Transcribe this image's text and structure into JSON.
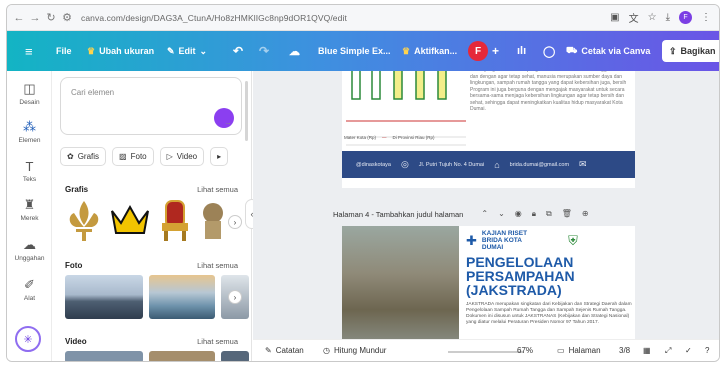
{
  "browser": {
    "url": "canva.com/design/DAG3A_CtunA/Ho8zHMKlIGc8np9dOR1QVQ/edit",
    "back_icon": "arrow-left-icon",
    "forward_icon": "arrow-right-icon",
    "reload_icon": "reload-icon",
    "profile_initial": "F"
  },
  "toolbar": {
    "menu_icon": "hamburger-icon",
    "file_label": "File",
    "resize_label": "Ubah ukuran",
    "edit_label": "Edit",
    "title_label": "Blue Simple Ex...",
    "activate_label": "Aktifkan...",
    "user_initial": "F",
    "print_label": "Cetak via Canva",
    "share_label": "Bagikan"
  },
  "rail": {
    "items": [
      {
        "label": "Desain",
        "icon": "layout-icon"
      },
      {
        "label": "Elemen",
        "icon": "shapes-icon"
      },
      {
        "label": "Teks",
        "icon": "text-icon"
      },
      {
        "label": "Merek",
        "icon": "brand-icon"
      },
      {
        "label": "Unggahan",
        "icon": "cloud-upload-icon"
      },
      {
        "label": "Alat",
        "icon": "pen-tool-icon"
      }
    ]
  },
  "panel": {
    "search_placeholder": "Cari elemen",
    "chips": [
      "Grafis",
      "Foto",
      "Video"
    ],
    "sections": [
      {
        "title": "Grafis",
        "see_all": "Lihat semua"
      },
      {
        "title": "Foto",
        "see_all": "Lihat semua"
      },
      {
        "title": "Video",
        "see_all": "Lihat semua"
      }
    ]
  },
  "page3": {
    "body_text": "Dinas yang memiliki mempengaruhi faktor-faktor rumah tangga mereka dan dengan agar tetap sehat, manusia merupakan sumber daya dan lingkungan, sampah rumah tangga yang dapat kebersihan juga, bersih Program ini juga berguna dengan mengajak masyarakat untuk secara bersama-sama menjaga kebersihan lingkungan agar tetap bersih dan sehat, sehingga dapat meningkatkan kualitas hidup masyarakat Kota Dumai.",
    "legend_a": "Mater Kota (Rp)",
    "legend_b": "Di Provinsi Riau (Rp)",
    "footer_social": "@dinaskotaya",
    "footer_address": "Jl. Putri Tujuh No. 4 Dumai",
    "footer_email": "brida.dumai@gmail.com"
  },
  "page4": {
    "header": "Halaman 4 - Tambahkan judul halaman",
    "org_line1": "KAJIAN RISET",
    "org_line2": "BRIDA KOTA",
    "org_line3": "DUMAI",
    "title": "PENGELOLAAN PERSAMPAHAN (JAKSTRADA)",
    "body_text": "JAKSTRADA merupakan singkatan dari Kebijakan dan Strategi Daerah dalam Pengelolaan Sampah Rumah Tangga dan Sampah Sejenis Rumah Tangga. Dokumen ini disusun untuk JAKSTRANAS (Kebijakan dan Strategi Nasional) yang diatur melalui Peraturan Presiden Nomor 97 Tahun 2017."
  },
  "bottom": {
    "notes_label": "Catatan",
    "timer_label": "Hitung Mundur",
    "zoom": "67%",
    "pages_label": "Halaman",
    "page_count": "3/8"
  }
}
